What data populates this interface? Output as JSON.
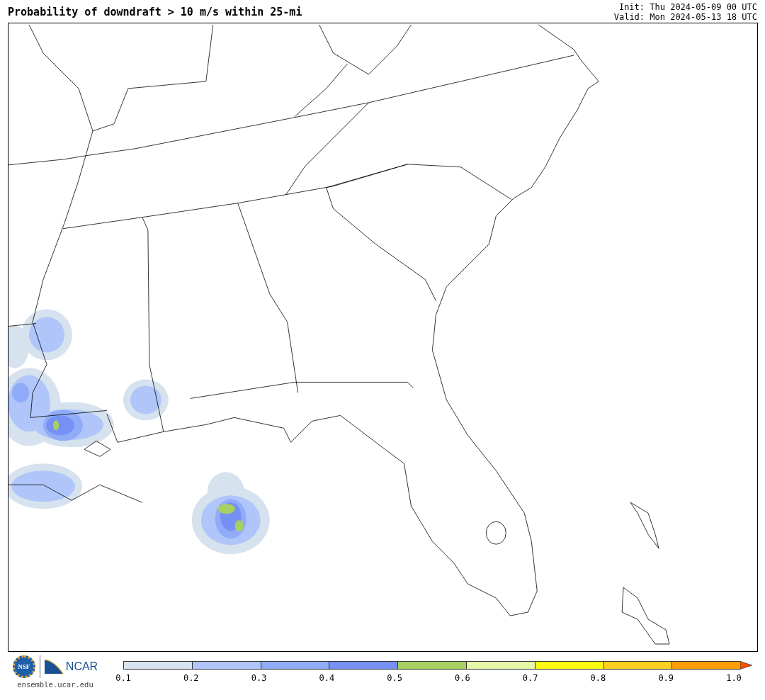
{
  "title": "Probability of downdraft > 10 m/s within 25-mi",
  "init": "Init: Thu 2024-05-09 00 UTC",
  "valid": "Valid: Mon 2024-05-13 18 UTC",
  "logos": {
    "seal": "NSF",
    "org": "NCAR",
    "url": "ensemble.ucar.edu"
  },
  "colorbar": {
    "bins": [
      {
        "color": "#d6e2ee"
      },
      {
        "color": "#b0c6fa"
      },
      {
        "color": "#90acf8"
      },
      {
        "color": "#7690f4"
      },
      {
        "color": "#a8d060"
      },
      {
        "color": "#e6f7a6"
      },
      {
        "color": "#fcfa12"
      },
      {
        "color": "#ffd020"
      },
      {
        "color": "#ff9e08"
      }
    ],
    "extend": {
      "color": "#ff4e00"
    },
    "ticks": [
      "0.1",
      "0.2",
      "0.3",
      "0.4",
      "0.5",
      "0.6",
      "0.7",
      "0.8",
      "0.9",
      "1.0"
    ]
  }
}
